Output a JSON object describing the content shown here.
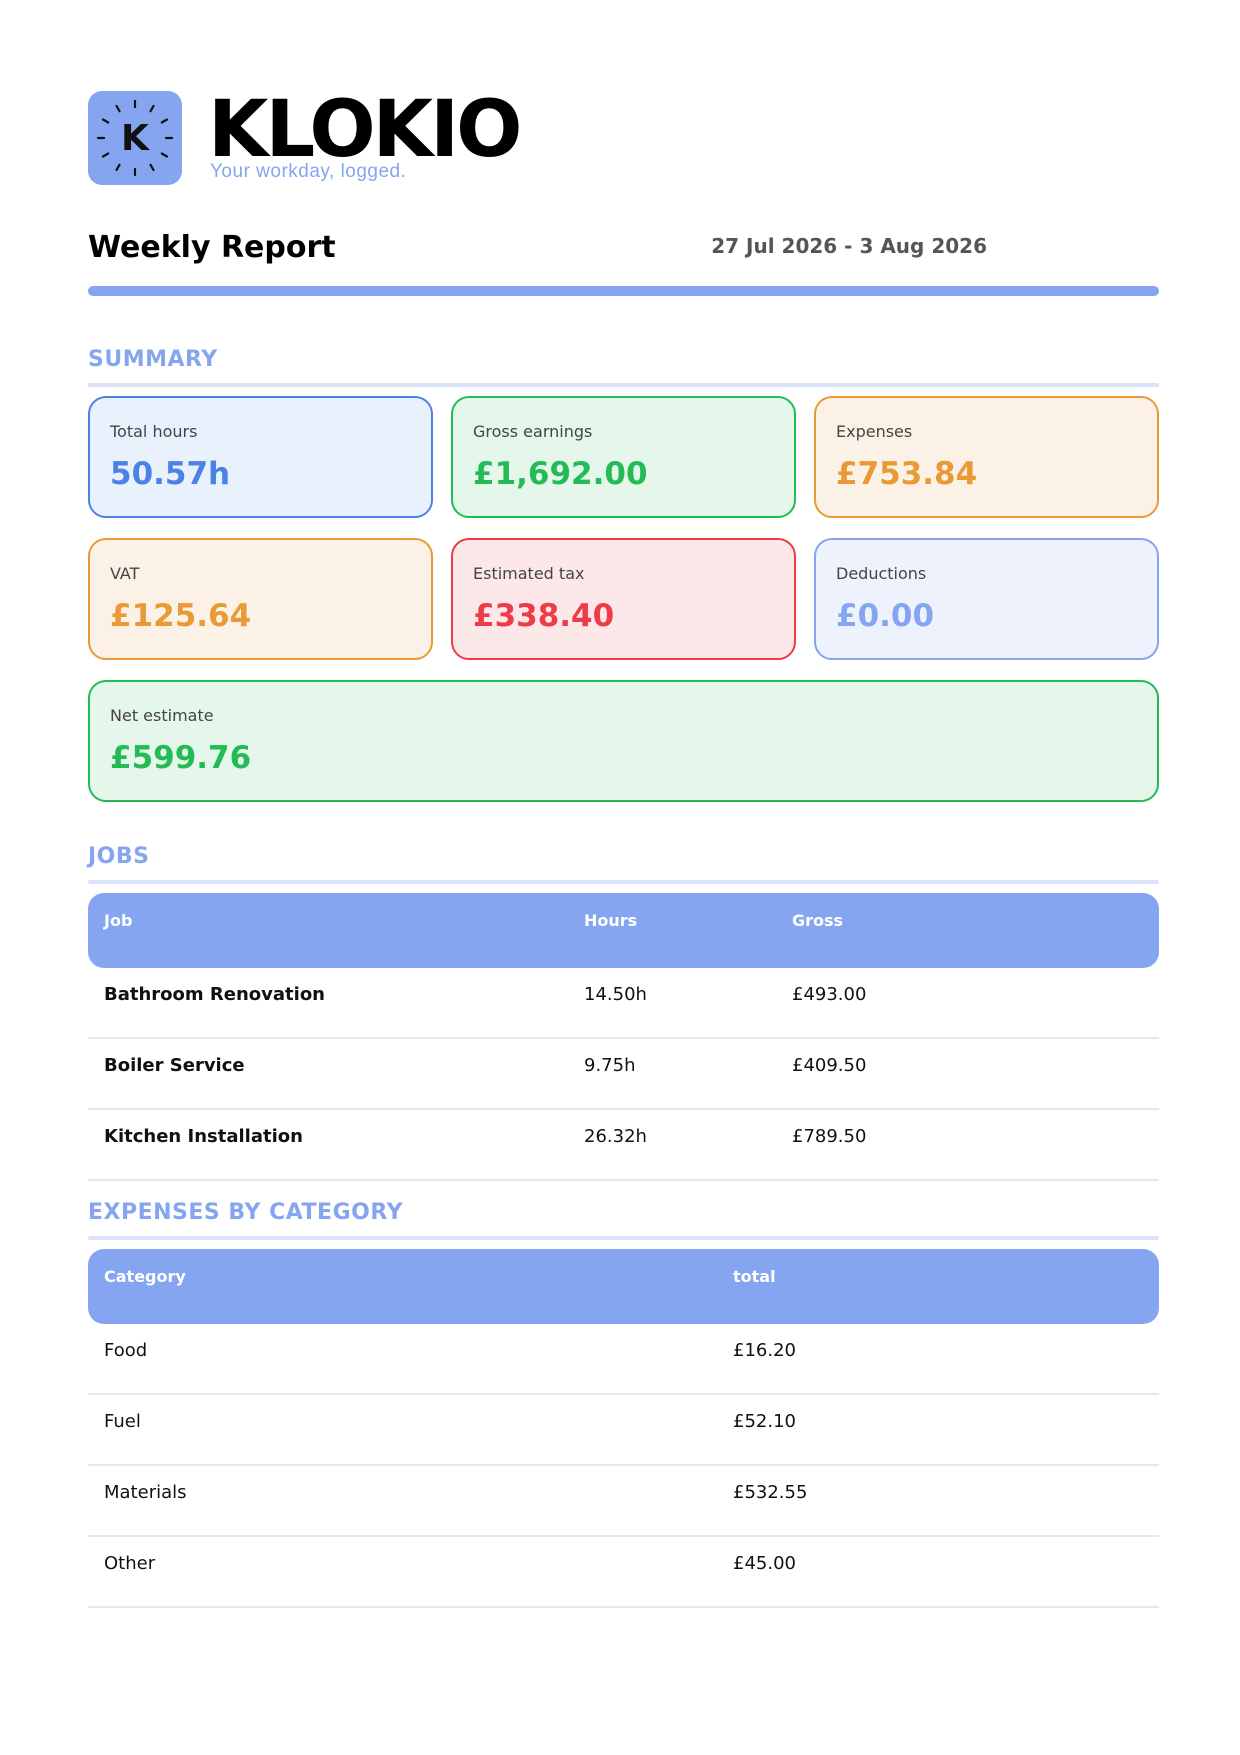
{
  "brand": {
    "name": "KLOKIO",
    "tagline": "Your workday, logged.",
    "logo_letter": "K",
    "accent_color": "#85a5f1"
  },
  "report": {
    "title": "Weekly Report",
    "date_range": "27 Jul 2026 - 3 Aug 2026"
  },
  "summary": {
    "heading": "SUMMARY",
    "cards": [
      {
        "label": "Total hours",
        "value": "50.57h",
        "color": "#4a82e6"
      },
      {
        "label": "Gross earnings",
        "value": "£1,692.00",
        "color": "#22bb55"
      },
      {
        "label": "Expenses",
        "value": "£753.84",
        "color": "#e99a34"
      },
      {
        "label": "VAT",
        "value": "£125.64",
        "color": "#e99a34"
      },
      {
        "label": "Estimated tax",
        "value": "£338.40",
        "color": "#ef3a48"
      },
      {
        "label": "Deductions",
        "value": "£0.00",
        "color": "#85a5f1"
      },
      {
        "label": "Net estimate",
        "value": "£599.76",
        "color": "#22bb55"
      }
    ]
  },
  "jobs": {
    "heading": "JOBS",
    "columns": [
      "Job",
      "Hours",
      "Gross"
    ],
    "rows": [
      [
        "Bathroom Renovation",
        "14.50h",
        "£493.00"
      ],
      [
        "Boiler Service",
        "9.75h",
        "£409.50"
      ],
      [
        "Kitchen Installation",
        "26.32h",
        "£789.50"
      ]
    ]
  },
  "expenses": {
    "heading": "EXPENSES BY CATEGORY",
    "columns": [
      "Category",
      "total"
    ],
    "rows": [
      [
        "Food",
        "£16.20"
      ],
      [
        "Fuel",
        "£52.10"
      ],
      [
        "Materials",
        "£532.55"
      ],
      [
        "Other",
        "£45.00"
      ]
    ]
  }
}
